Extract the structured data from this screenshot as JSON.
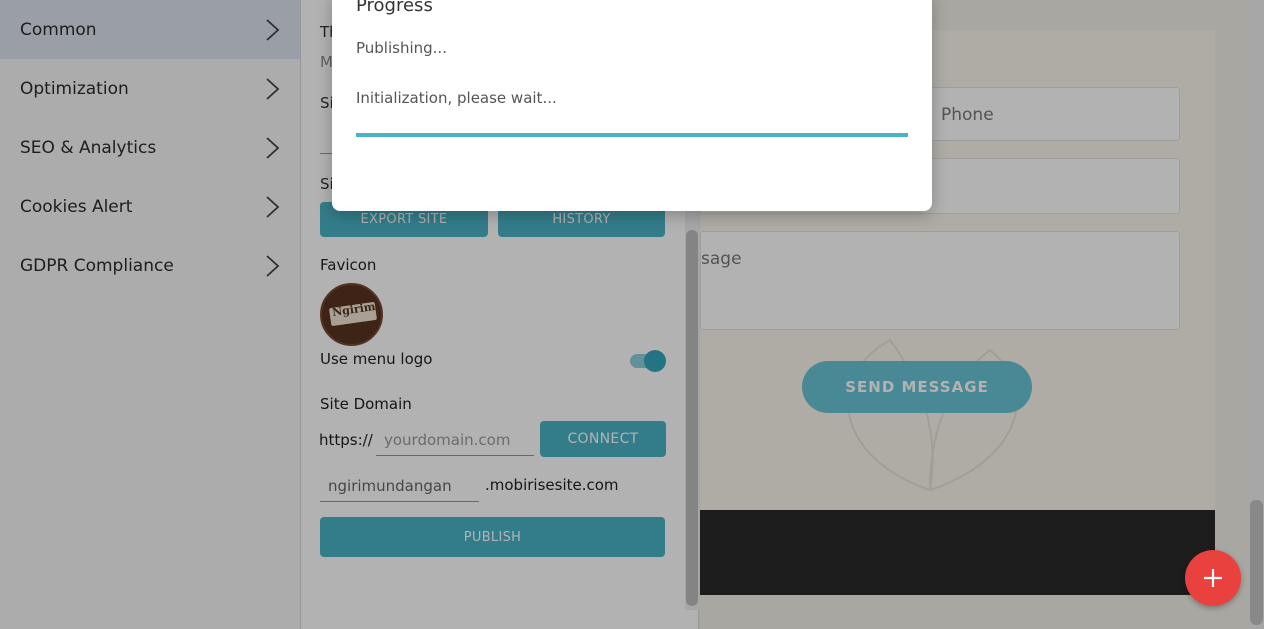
{
  "nav": {
    "items": [
      {
        "label": "Common",
        "active": true
      },
      {
        "label": "Optimization",
        "active": false
      },
      {
        "label": "SEO & Analytics",
        "active": false
      },
      {
        "label": "Cookies Alert",
        "active": false
      },
      {
        "label": "GDPR Compliance",
        "active": false
      }
    ]
  },
  "panel": {
    "partial_labels": [
      "Th",
      "M",
      "Si",
      "Si"
    ],
    "export_site": "EXPORT SITE",
    "history": "HISTORY",
    "favicon_label": "Favicon",
    "favicon_text": "Ngirim",
    "use_menu_logo": "Use menu logo",
    "use_menu_logo_on": true,
    "site_domain_label": "Site Domain",
    "https_prefix": "https://",
    "domain_placeholder": "yourdomain.com",
    "connect": "CONNECT",
    "subdomain_value": "ngirimundangan",
    "subdomain_suffix": ".mobirisesite.com",
    "publish": "PUBLISH"
  },
  "preview": {
    "phone_placeholder": "Phone",
    "message_placeholder_partial": "sage",
    "send_message": "SEND MESSAGE"
  },
  "dialog": {
    "title": "Progress",
    "status": "Publishing...",
    "detail": "Initialization, please wait...",
    "progress": 1.0
  },
  "colors": {
    "accent": "#4ab3c6",
    "fab": "#e8413e",
    "nav_active": "#dde3ef"
  },
  "icons": {
    "chevron": "chevron-right-icon",
    "fab": "plus-icon"
  }
}
